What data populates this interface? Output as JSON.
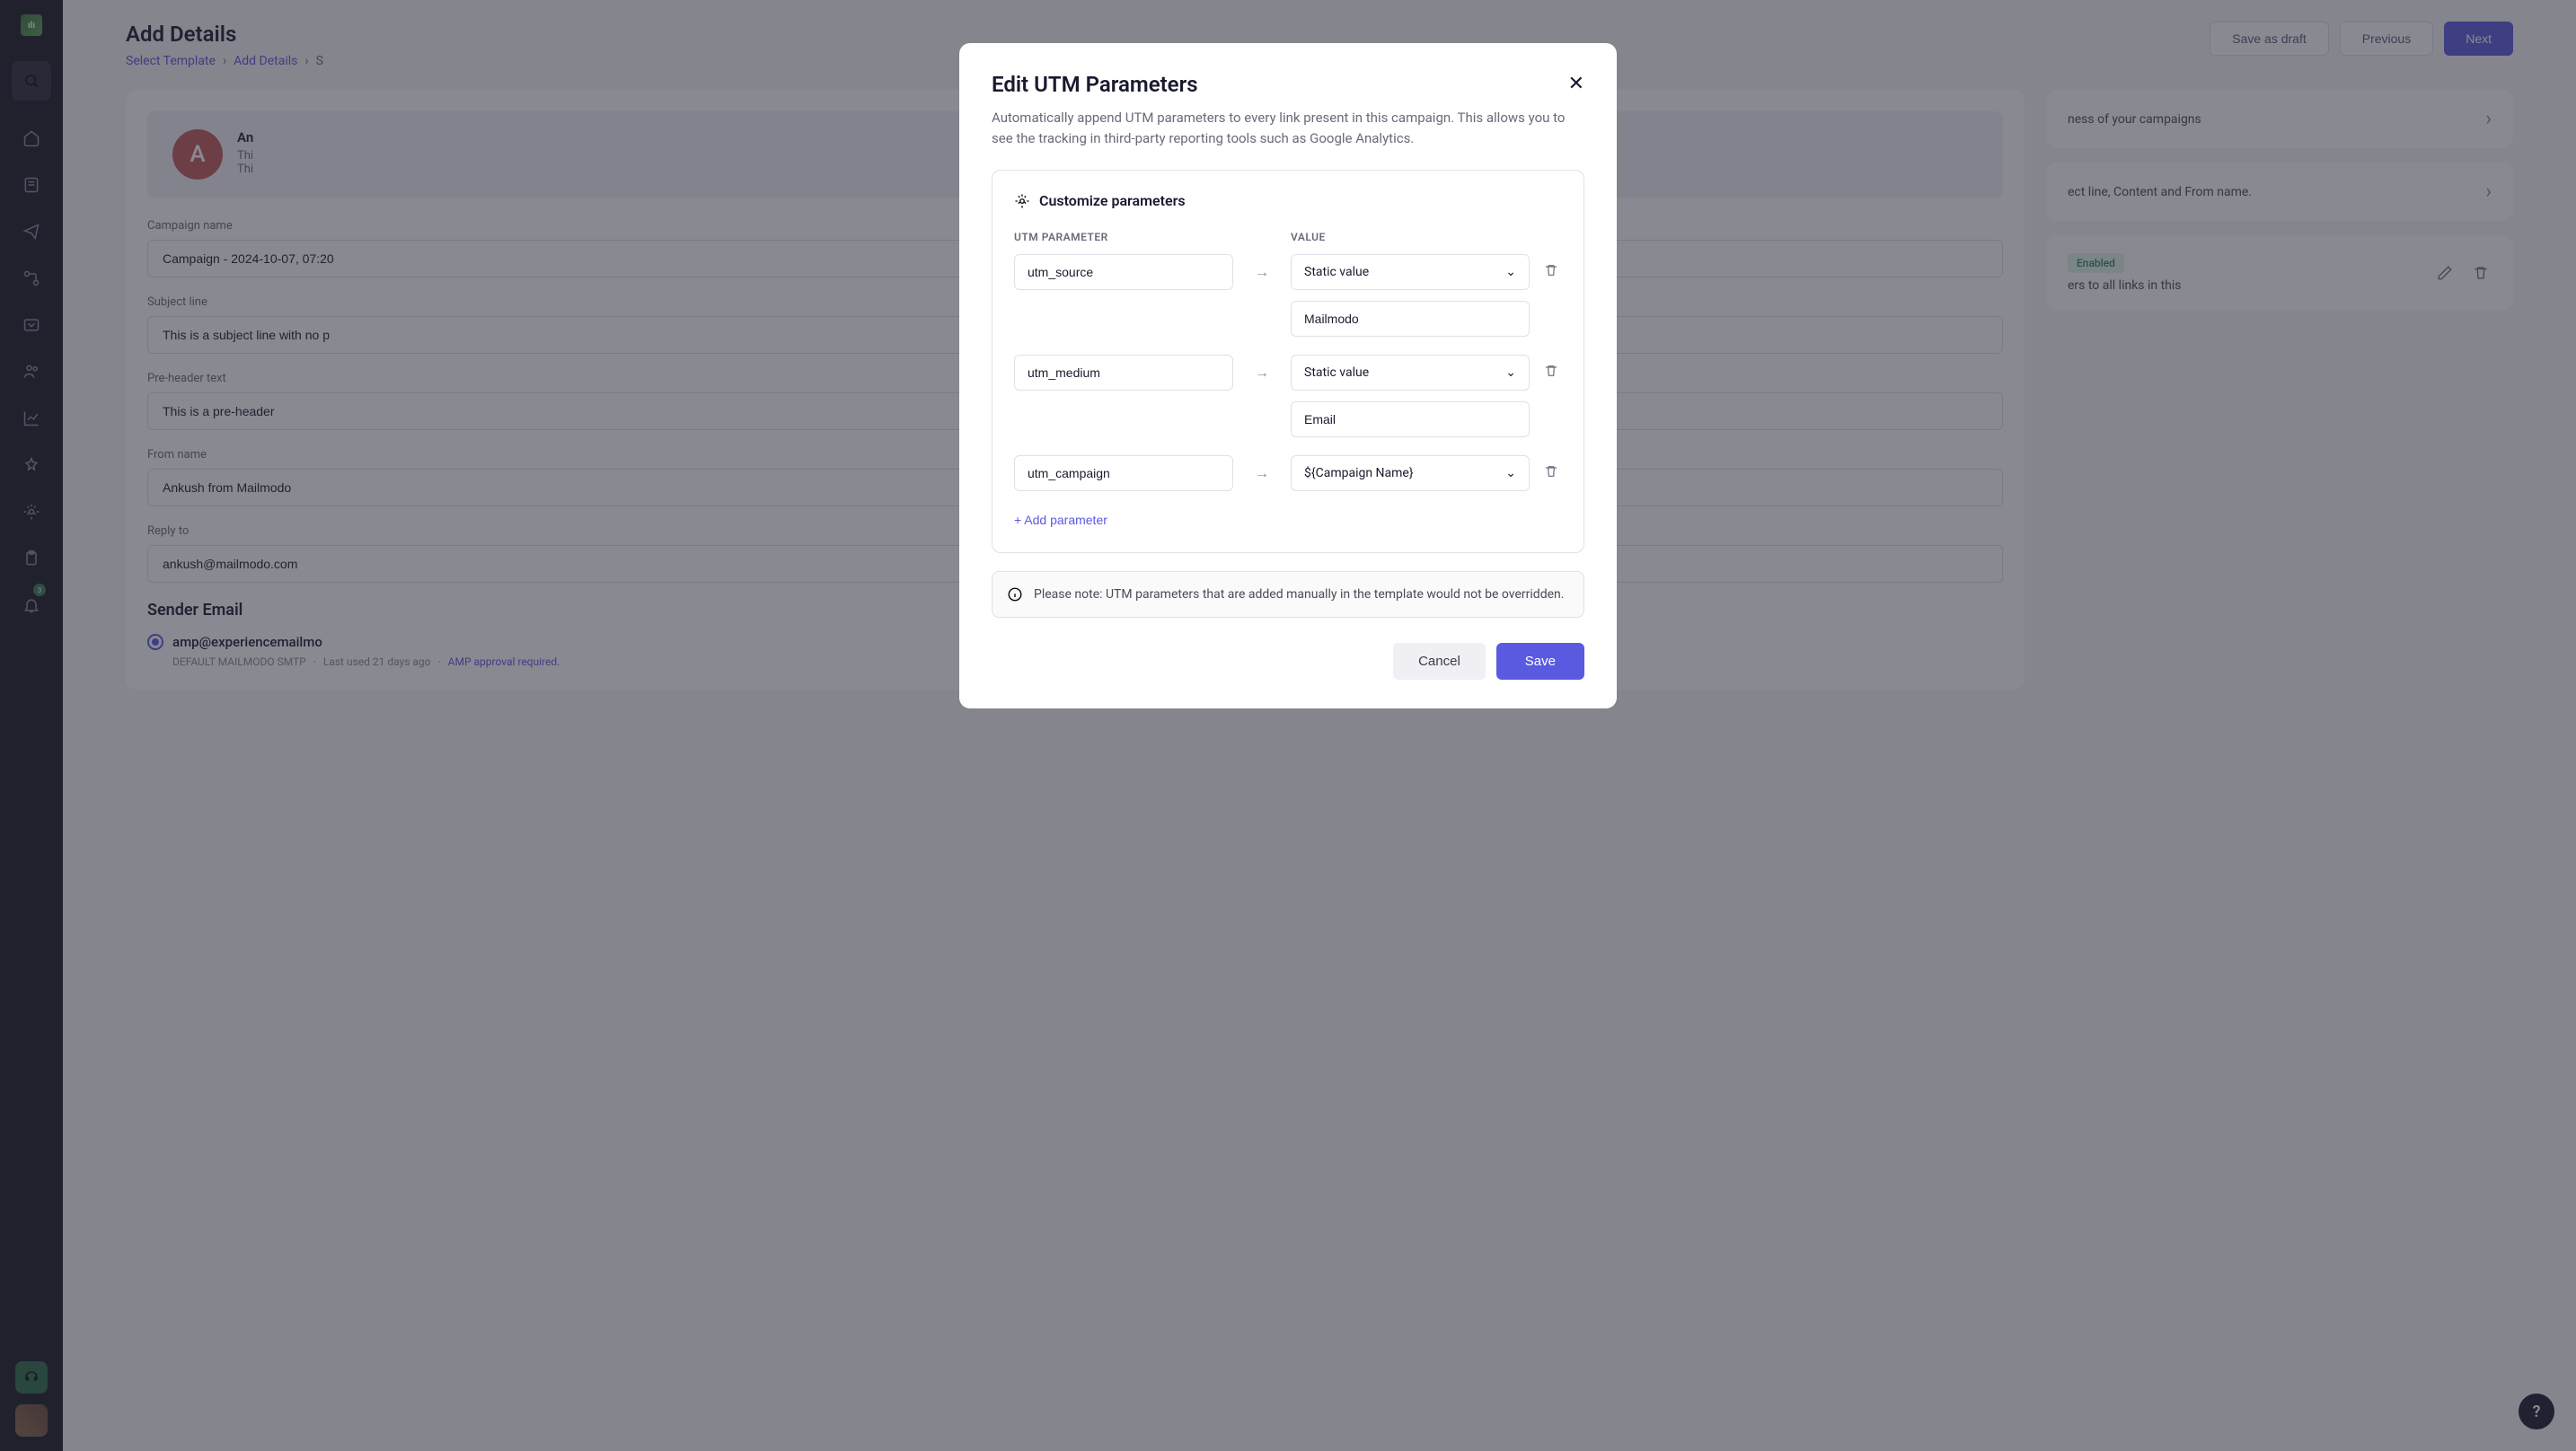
{
  "page": {
    "title": "Add Details",
    "breadcrumb": [
      "Select Template",
      "Add Details",
      "S"
    ]
  },
  "header_actions": {
    "save_draft": "Save as draft",
    "previous": "Previous",
    "next": "Next"
  },
  "preview": {
    "avatar_initial": "A",
    "from_name": "An",
    "line1": "Thi",
    "line2": "Thi"
  },
  "form": {
    "campaign_name": {
      "label": "Campaign name",
      "value": "Campaign - 2024-10-07, 07:20"
    },
    "subject": {
      "label": "Subject line",
      "value": "This is a subject line with no p"
    },
    "preheader": {
      "label": "Pre-header text",
      "value": "This is a pre-header"
    },
    "from_name": {
      "label": "From name",
      "value": "Ankush from Mailmodo"
    },
    "reply_to": {
      "label": "Reply to",
      "value": "ankush@mailmodo.com"
    }
  },
  "sender": {
    "heading": "Sender Email",
    "email": "amp@experiencemailmo",
    "smtp": "DEFAULT MAILMODO SMTP",
    "last_used": "Last used 21 days ago",
    "amp_note": "AMP approval required."
  },
  "right": {
    "card1": "ness of your campaigns",
    "card2": "ect line, Content and From name.",
    "card3_badge": "Enabled",
    "card3_text": "ers to all links in this"
  },
  "modal": {
    "title": "Edit UTM Parameters",
    "description": "Automatically append UTM parameters to every link present in this campaign. This allows you to see the tracking in third-party reporting tools such as Google Analytics.",
    "customize": "Customize parameters",
    "col_param": "UTM PARAMETER",
    "col_value": "VALUE",
    "params": [
      {
        "name": "utm_source",
        "type": "Static value",
        "value": "Mailmodo"
      },
      {
        "name": "utm_medium",
        "type": "Static value",
        "value": "Email"
      },
      {
        "name": "utm_campaign",
        "type": "${Campaign Name}",
        "value": null
      }
    ],
    "add_param": "+ Add parameter",
    "note": "Please note: UTM parameters that are added manually in the template would not be overridden.",
    "cancel": "Cancel",
    "save": "Save"
  },
  "sidebar_badge": "3",
  "fab": "?"
}
